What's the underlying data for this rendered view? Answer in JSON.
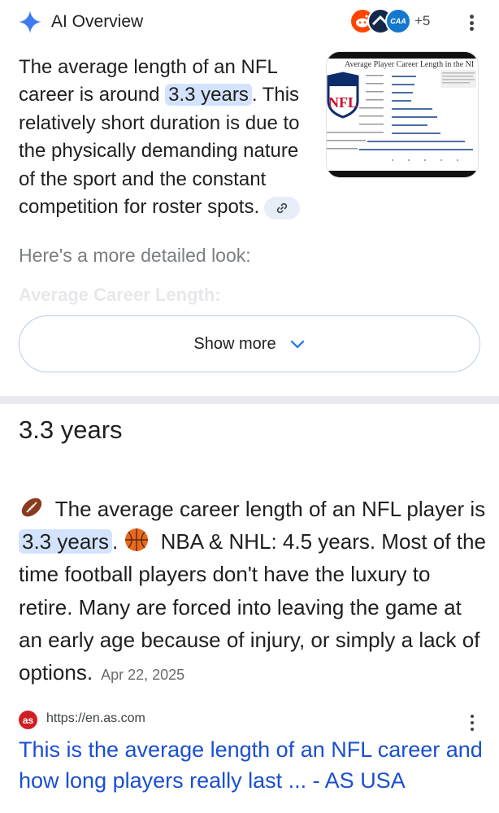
{
  "ai_overview": {
    "title": "AI Overview",
    "source_count": "+5",
    "source_badge_text": "CAA",
    "summary_pre": "The average length of an NFL career is around ",
    "summary_highlight": "3.3 years",
    "summary_post": ". This relatively short duration is due to the physically demanding nature of the sport and the constant competition for roster spots.",
    "thumbnail_title": "Average Player Career Length in the NI",
    "thumbnail_logo": "NFL",
    "detailed_heading": "Here's a more detailed look:",
    "faded_heading": "Average Career Length:",
    "show_more_label": "Show more"
  },
  "featured": {
    "answer": "3.3 years",
    "snippet_pre": " The average career length of an NFL player is ",
    "snippet_highlight": "3.3 years",
    "snippet_post": ". ",
    "snippet_rest": " NBA & NHL: 4.5 years. Most of the time football players don't have the luxury to retire. Many are forced into leaving the game at an early age because of injury, or simply a lack of options.",
    "date": "Apr 22, 2025",
    "source_logo": "as",
    "source_url": "https://en.as.com",
    "link_title": "This is the average length of an NFL career and how long players really last ... - AS USA"
  },
  "colors": {
    "highlight": "#d3e3fd",
    "link": "#1a4fd0",
    "accent": "#1a73e8"
  },
  "icons": [
    "sparkle-icon",
    "reddit-icon",
    "kebab-menu-icon",
    "link-icon",
    "chevron-down-icon",
    "football-emoji-icon",
    "basketball-emoji-icon"
  ]
}
